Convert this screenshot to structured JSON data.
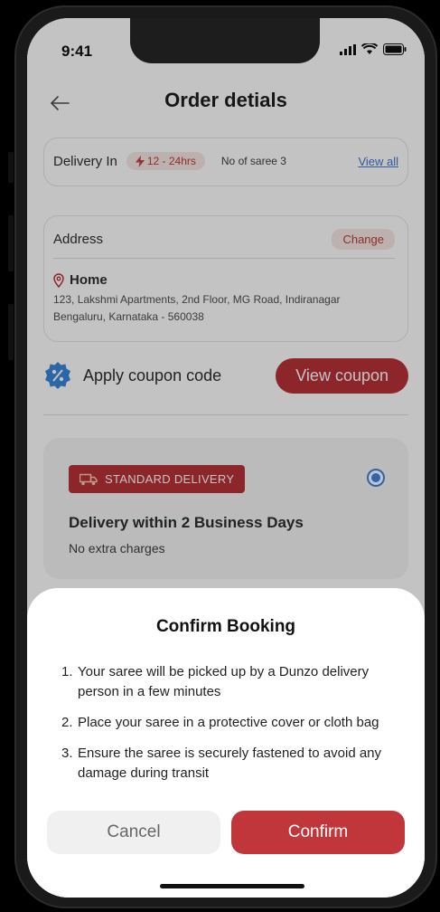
{
  "status_bar": {
    "time": "9:41"
  },
  "header": {
    "title": "Order detials"
  },
  "delivery": {
    "label": "Delivery In",
    "time_range": "12 - 24hrs",
    "saree_count": "No of saree 3",
    "view_all": "View all"
  },
  "address": {
    "title": "Address",
    "change": "Change",
    "name": "Home",
    "line1": "123, Lakshmi Apartments, 2nd Floor, MG Road, Indiranagar",
    "line2": "Bengaluru, Karnataka - 560038"
  },
  "coupon": {
    "label": "Apply coupon code",
    "button": "View coupon"
  },
  "delivery_option": {
    "badge": "STANDARD DELIVERY",
    "title": "Delivery within 2 Business Days",
    "subtitle": "No extra charges",
    "selected": true
  },
  "sheet": {
    "title": "Confirm Booking",
    "steps": [
      {
        "num": "1.",
        "text": "Your saree will be picked up by a Dunzo delivery person in a few minutes"
      },
      {
        "num": "2.",
        "text": "Place your saree in a protective cover or cloth bag"
      },
      {
        "num": "3.",
        "text": "Ensure the saree is securely fastened to avoid any damage during transit"
      }
    ],
    "cancel": "Cancel",
    "confirm": "Confirm"
  },
  "icons": {
    "back": "back-arrow-icon",
    "lightning": "lightning-icon",
    "location": "location-pin-icon",
    "coupon": "discount-badge-icon",
    "truck": "truck-icon"
  },
  "colors": {
    "accent": "#b3262b",
    "link": "#3b6cc9",
    "radio": "#2f7de1"
  }
}
